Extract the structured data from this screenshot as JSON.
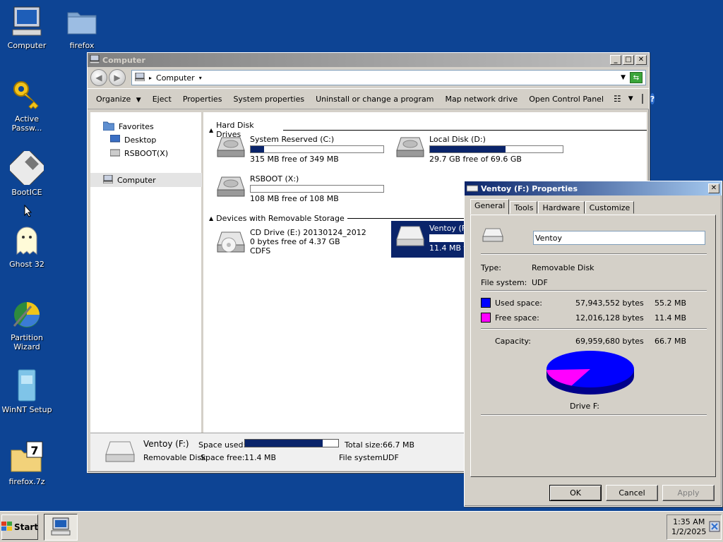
{
  "desktop": {
    "icons": [
      {
        "label": "Computer"
      },
      {
        "label": "firefox"
      },
      {
        "label": "Active\nPassw..."
      },
      {
        "label": "BootICE"
      },
      {
        "label": "Ghost 32"
      },
      {
        "label": "Partition\nWizard"
      },
      {
        "label": "WinNT Setup"
      },
      {
        "label": "firefox.7z"
      }
    ]
  },
  "explorer": {
    "title": "Computer",
    "address": "Computer",
    "commands": [
      "Organize",
      "Eject",
      "Properties",
      "System properties",
      "Uninstall or change a program",
      "Map network drive",
      "Open Control Panel"
    ],
    "nav": {
      "favorites": "Favorites",
      "desktop": "Desktop",
      "rsboot": "RSBOOT(X)",
      "computer": "Computer"
    },
    "groups": {
      "hdd": "Hard Disk Drives",
      "removable": "Devices with Removable Storage"
    },
    "drives": {
      "c": {
        "name": "System Reserved (C:)",
        "free": "315 MB free of 349 MB",
        "used_fraction": 0.1
      },
      "d": {
        "name": "Local Disk (D:)",
        "free": "29.7 GB free of 69.6 GB",
        "used_fraction": 0.57
      },
      "x": {
        "name": "RSBOOT (X:)",
        "free": "108 MB free of 108 MB",
        "used_fraction": 0.0
      },
      "e": {
        "name": "CD Drive (E:) 20130124_2012",
        "free": "0 bytes free of 4.37 GB",
        "fs": "CDFS"
      },
      "f": {
        "name": "Ventoy (F",
        "free": "11.4 MB f"
      }
    },
    "details": {
      "name": "Ventoy (F:)",
      "type": "Removable Disk",
      "space_used_label": "Space used:",
      "space_free_label": "Space free:",
      "space_free": "11.4 MB",
      "total_label": "Total size:",
      "total": "66.7 MB",
      "fs_label": "File system:",
      "fs": "UDF",
      "used_fraction": 0.83
    }
  },
  "dialog": {
    "title": "Ventoy (F:) Properties",
    "tabs": [
      "General",
      "Tools",
      "Hardware",
      "Customize"
    ],
    "volume_name": "Ventoy",
    "type_label": "Type:",
    "type_value": "Removable Disk",
    "fs_label": "File system:",
    "fs_value": "UDF",
    "used_label": "Used space:",
    "used_bytes": "57,943,552 bytes",
    "used_size": "55.2 MB",
    "free_label": "Free space:",
    "free_bytes": "12,016,128 bytes",
    "free_size": "11.4 MB",
    "capacity_label": "Capacity:",
    "capacity_bytes": "69,959,680 bytes",
    "capacity_size": "66.7 MB",
    "drive_label": "Drive F:",
    "used_color": "#0000ff",
    "free_color": "#ff00ff",
    "buttons": {
      "ok": "OK",
      "cancel": "Cancel",
      "apply": "Apply"
    }
  },
  "taskbar": {
    "start": "Start",
    "time": "1:35 AM",
    "date": "1/2/2025"
  }
}
